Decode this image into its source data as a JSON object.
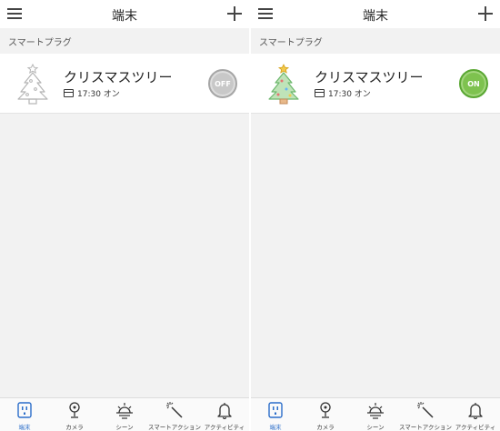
{
  "screens": [
    {
      "header": {
        "title": "端末"
      },
      "section_label": "スマートプラグ",
      "device": {
        "name": "クリスマスツリー",
        "schedule": "17:30 オン",
        "toggle_label": "OFF",
        "state": "off"
      },
      "tabs": [
        {
          "label": "端末",
          "icon": "plug-icon"
        },
        {
          "label": "カメラ",
          "icon": "camera-icon"
        },
        {
          "label": "シーン",
          "icon": "sunrise-icon"
        },
        {
          "label": "スマートアクション",
          "icon": "magic-wand-icon"
        },
        {
          "label": "アクティビティ",
          "icon": "bell-icon"
        }
      ]
    },
    {
      "header": {
        "title": "端末"
      },
      "section_label": "スマートプラグ",
      "device": {
        "name": "クリスマスツリー",
        "schedule": "17:30 オン",
        "toggle_label": "ON",
        "state": "on"
      },
      "tabs": [
        {
          "label": "端末",
          "icon": "plug-icon"
        },
        {
          "label": "カメラ",
          "icon": "camera-icon"
        },
        {
          "label": "シーン",
          "icon": "sunrise-icon"
        },
        {
          "label": "スマートアクション",
          "icon": "magic-wand-icon"
        },
        {
          "label": "アクティビティ",
          "icon": "bell-icon"
        }
      ]
    }
  ],
  "colors": {
    "active_tab": "#2b6dc9",
    "toggle_on": "#7ec24f",
    "toggle_off": "#c8c8c8",
    "tree_active": "#6db86d",
    "tree_inactive": "#b5b5b5"
  }
}
